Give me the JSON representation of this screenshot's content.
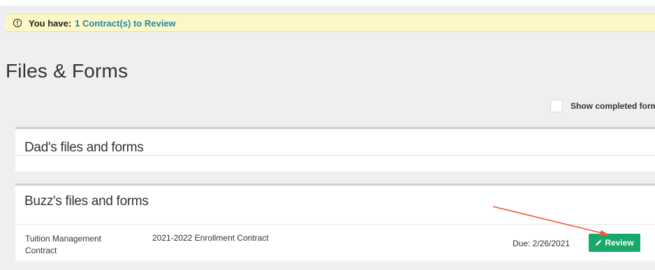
{
  "alert": {
    "prefix": "You have:",
    "link": "1 Contract(s) to Review",
    "icon": "exclamation-circle-icon"
  },
  "page": {
    "title": "Files & Forms"
  },
  "filters": {
    "show_completed_label": "Show completed form"
  },
  "sections": [
    {
      "title": "Dad's files and forms"
    },
    {
      "title": "Buzz's files and forms",
      "row": {
        "type": "Tuition Management Contract",
        "name": "2021-2022 Enrollment Contract",
        "due": "Due: 2/26/2021",
        "action": "Review",
        "action_icon": "pencil-icon"
      }
    }
  ],
  "colors": {
    "alert_bg": "#fcf8c6",
    "link": "#1f88a8",
    "button": "#17a86a",
    "annotation_arrow": "#ee5a37"
  }
}
